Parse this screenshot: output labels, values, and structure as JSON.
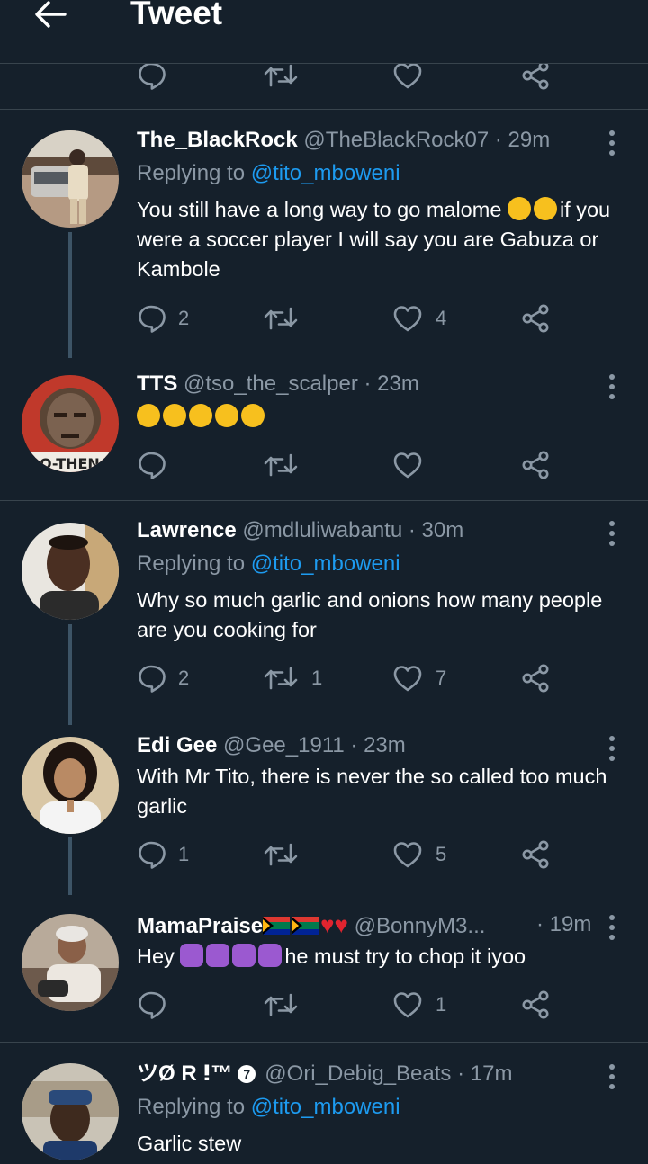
{
  "header": {
    "title": "Tweet",
    "back_icon": "arrow-left-icon"
  },
  "colors": {
    "bg": "#15202b",
    "link": "#1d9bf0",
    "muted": "#8b98a5",
    "divider": "#38444d"
  },
  "tweets": [
    {
      "name": "The_BlackRock",
      "handle": "@TheBlackRock07",
      "time": "· 29m",
      "replying_prefix": "Replying to",
      "replying_to": "@tito_mboweni",
      "text_a": "You still have a long way to go malome",
      "text_b": "if you were a soccer player I will say you are Gabuza or Kambole",
      "replies": "2",
      "retweets": "",
      "likes": "4"
    },
    {
      "name": "TTS",
      "handle": "@tso_the_scalper",
      "time": "· 23m",
      "text": "",
      "replies": "",
      "retweets": "",
      "likes": "",
      "avatar_text": "O-THEN"
    },
    {
      "name": "Lawrence",
      "handle": "@mdluliwabantu",
      "time": "· 30m",
      "replying_prefix": "Replying to",
      "replying_to": "@tito_mboweni",
      "text": "Why so much garlic and onions how many people are you cooking for",
      "replies": "2",
      "retweets": "1",
      "likes": "7"
    },
    {
      "name": "Edi Gee",
      "handle": "@Gee_1911",
      "time": "· 23m",
      "text": "With Mr Tito, there is never the so called too much garlic",
      "replies": "1",
      "retweets": "",
      "likes": "5"
    },
    {
      "name": "MamaPraise",
      "handle": "@BonnyM3...",
      "time": "· 19m",
      "text_a": "Hey",
      "text_b": "he must try to chop it iyoo",
      "replies": "",
      "retweets": "",
      "likes": "1"
    },
    {
      "name": "ツØ R ⵑ™",
      "badge": "7",
      "handle": "@Ori_Debig_Beats",
      "time": "· 17m",
      "replying_prefix": "Replying to",
      "replying_to": "@tito_mboweni",
      "text": "Garlic stew"
    }
  ]
}
